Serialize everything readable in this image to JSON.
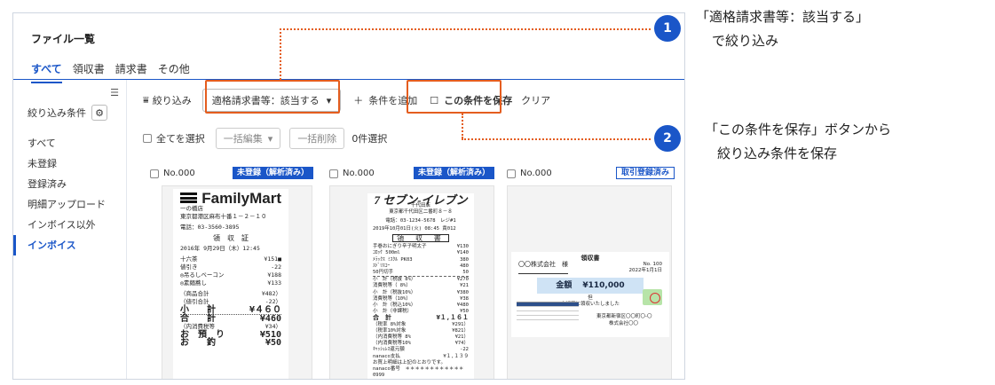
{
  "app": {
    "title": "ファイル一覧",
    "tabs": [
      "すべて",
      "領収書",
      "請求書",
      "その他"
    ]
  },
  "sidebar": {
    "collapse_icon": "collapse-menu-icon",
    "filter_heading": "絞り込み条件",
    "items": [
      "すべて",
      "未登録",
      "登録済み",
      "明細アップロード",
      "インボイス以外",
      "インボイス"
    ],
    "active_item": "インボイス"
  },
  "toolbar": {
    "filter_label": "絞り込み",
    "filter_chip": "適格請求書等：該当する",
    "add_condition": "条件を追加",
    "save_condition": "この条件を保存",
    "clear": "クリア"
  },
  "selection": {
    "select_all": "全てを選択",
    "bulk_edit": "一括編集",
    "bulk_delete": "一括削除",
    "selected_count": "0件選択"
  },
  "cards": [
    {
      "number": "No.000",
      "badge": "未登録（解析済み）",
      "badge_style": "fill",
      "receipt": {
        "logo": "FamilyMart",
        "lines": [
          "一の橋店",
          "東京都港区麻布十番１－２－１０",
          "",
          "電話：03-3560-3895",
          "",
          "領　収　証",
          "",
          "2016年 9月29日（木）12:45"
        ],
        "items": [
          [
            "十六茶",
            "¥151■"
          ],
          [
            "値引き",
            "-22"
          ],
          [
            "◎吊るしベーコン",
            "¥188"
          ],
          [
            "◎素麺蕎し",
            "¥133"
          ]
        ],
        "subtotals": [
          [
            "（商品合計",
            "¥482）"
          ],
          [
            "（値引合計",
            "-22）"
          ],
          [
            "小　　計",
            "¥４６０"
          ]
        ],
        "totals": [
          [
            "合　　計",
            "¥460"
          ],
          [
            "（内消費税等",
            "¥34）"
          ],
          [
            "お　預　り",
            "¥510"
          ],
          [
            "お　　釣",
            "¥50"
          ]
        ]
      }
    },
    {
      "number": "No.000",
      "badge": "未登録（解析済み）",
      "badge_style": "fill",
      "receipt": {
        "logo": "7 セブン-イレブン",
        "lines": [
          "千代田店",
          "東京都千代田区二番町８－８",
          "電話：03-1234-5678　レジ#1",
          "2019年10月01日(火) 08:45 責012"
        ],
        "title": "領 収 書",
        "items": [
          [
            "手巻おにぎり辛子明太子",
            "¥130"
          ],
          [
            "ｺﾛｯｹ 500ml",
            "¥140"
          ],
          [
            "ﾒﾗｯｸｽ ﾐｽｸﾙ PK03",
            "380"
          ],
          [
            "ｽﾄﾞﾘｽｺｰ",
            "480"
          ],
          [
            "50円切手",
            "50"
          ]
        ],
        "totals": [
          [
            "小　計（税抜 8%）",
            "¥270"
          ],
          [
            "消費税等（ 8%）",
            "¥21"
          ],
          [
            "小　計（税抜10%）",
            "¥380"
          ],
          [
            "消費税等（10%）",
            "¥38"
          ],
          [
            "小　計（税込10%）",
            "¥480"
          ],
          [
            "小　計（非課税）",
            "¥50"
          ],
          [
            "合　計",
            "¥１,１６１"
          ],
          [
            "（税率 8%対象",
            "¥291）"
          ],
          [
            "（税率10%対象",
            "¥821）"
          ],
          [
            "（内消費税等 8%",
            "¥21）"
          ],
          [
            "（内消費税等10%",
            "¥74）"
          ],
          [
            "ｷｬｯｼｭﾚｽ還元額",
            "-22"
          ],
          [
            "nanaco支払",
            "¥１,１３９"
          ]
        ],
        "footer": [
          "お買上明細は上記のとおりです。",
          "nanaco番号　＊＊＊＊＊＊＊＊＊＊＊＊0999"
        ]
      }
    },
    {
      "number": "No.000",
      "badge": "取引登録済み",
      "badge_style": "outline",
      "receipt": {
        "heading": "領収書",
        "recipient": "〇〇株式会社　様",
        "no": "No. 100",
        "date": "2022年1月1日",
        "amount_label": "金額",
        "amount": "¥110,000",
        "note": "但",
        "received": "上記正に領収いたしました",
        "issuer_address": "東京都新宿区〇〇町〇-〇",
        "issuer": "株式会社〇〇"
      }
    }
  ],
  "annotations": [
    {
      "number": "1",
      "lines": [
        "「適格請求書等：該当する」",
        "で絞り込み"
      ]
    },
    {
      "number": "2",
      "lines": [
        "「この条件を保存」ボタンから",
        "絞り込み条件を保存"
      ]
    }
  ],
  "colors": {
    "accent": "#1a56c8",
    "highlight": "#e45d1f",
    "badge_fill": "#1a56c8"
  }
}
